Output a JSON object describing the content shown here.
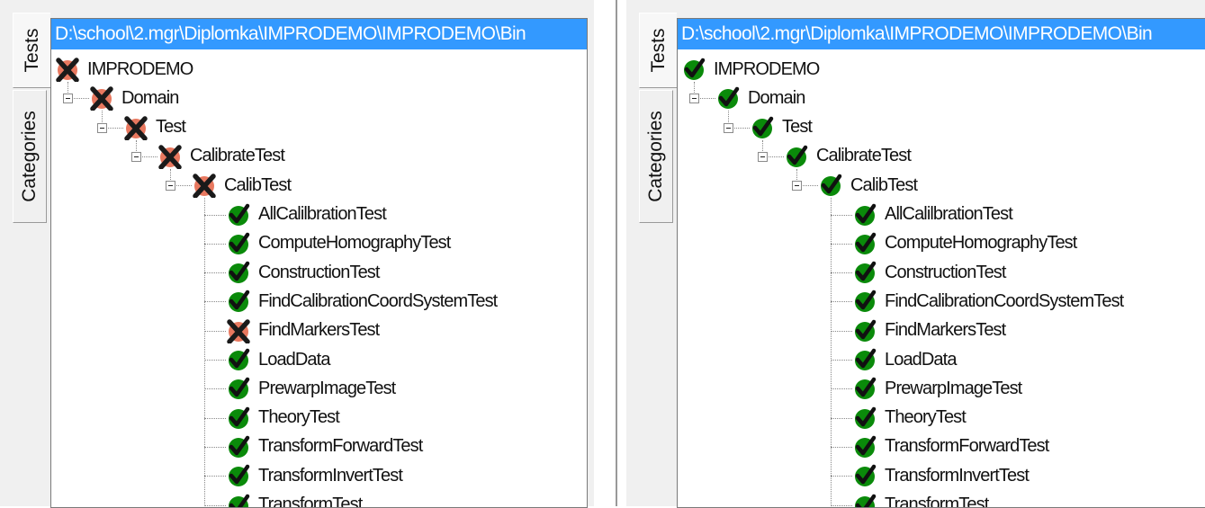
{
  "colors": {
    "selection": "#3399ff",
    "pass": "#0a8a0a",
    "fail_bg": "#e8785f",
    "fail_x": "#1a1a1a"
  },
  "tabs": [
    "Tests",
    "Categories"
  ],
  "panels": [
    {
      "path": "D:\\school\\2.mgr\\Diplomka\\IMPRODEMO\\IMPRODEMO\\Bin",
      "nodes": [
        {
          "label": "IMPRODEMO",
          "status": "fail"
        },
        {
          "label": "Domain",
          "status": "fail"
        },
        {
          "label": "Test",
          "status": "fail"
        },
        {
          "label": "CalibrateTest",
          "status": "fail"
        },
        {
          "label": "CalibTest",
          "status": "fail"
        },
        {
          "label": "AllCalilbrationTest",
          "status": "pass"
        },
        {
          "label": "ComputeHomographyTest",
          "status": "pass"
        },
        {
          "label": "ConstructionTest",
          "status": "pass"
        },
        {
          "label": "FindCalibrationCoordSystemTest",
          "status": "pass"
        },
        {
          "label": "FindMarkersTest",
          "status": "fail"
        },
        {
          "label": "LoadData",
          "status": "pass"
        },
        {
          "label": "PrewarpImageTest",
          "status": "pass"
        },
        {
          "label": "TheoryTest",
          "status": "pass"
        },
        {
          "label": "TransformForwardTest",
          "status": "pass"
        },
        {
          "label": "TransformInvertTest",
          "status": "pass"
        },
        {
          "label": "TransformTest",
          "status": "pass"
        }
      ]
    },
    {
      "path": "D:\\school\\2.mgr\\Diplomka\\IMPRODEMO\\IMPRODEMO\\Bin",
      "nodes": [
        {
          "label": "IMPRODEMO",
          "status": "pass"
        },
        {
          "label": "Domain",
          "status": "pass"
        },
        {
          "label": "Test",
          "status": "pass"
        },
        {
          "label": "CalibrateTest",
          "status": "pass"
        },
        {
          "label": "CalibTest",
          "status": "pass"
        },
        {
          "label": "AllCalilbrationTest",
          "status": "pass"
        },
        {
          "label": "ComputeHomographyTest",
          "status": "pass"
        },
        {
          "label": "ConstructionTest",
          "status": "pass"
        },
        {
          "label": "FindCalibrationCoordSystemTest",
          "status": "pass"
        },
        {
          "label": "FindMarkersTest",
          "status": "pass"
        },
        {
          "label": "LoadData",
          "status": "pass"
        },
        {
          "label": "PrewarpImageTest",
          "status": "pass"
        },
        {
          "label": "TheoryTest",
          "status": "pass"
        },
        {
          "label": "TransformForwardTest",
          "status": "pass"
        },
        {
          "label": "TransformInvertTest",
          "status": "pass"
        },
        {
          "label": "TransformTest",
          "status": "pass"
        }
      ]
    }
  ]
}
